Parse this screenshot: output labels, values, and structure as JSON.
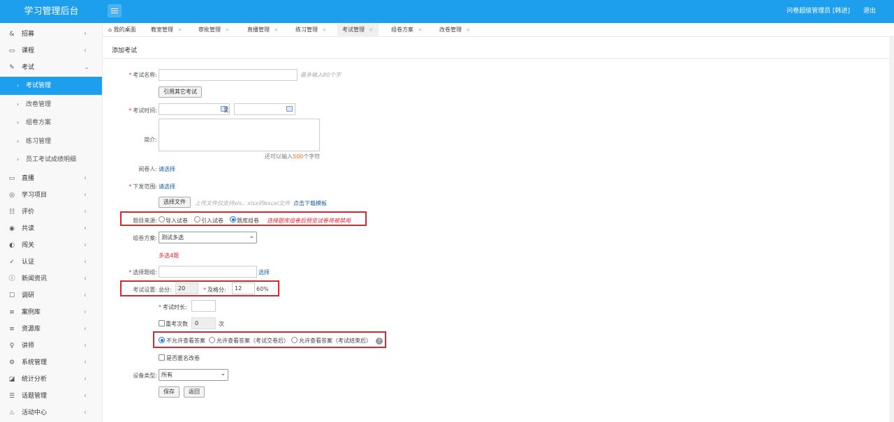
{
  "header": {
    "brand": "学习管理后台",
    "user": "问卷超级管理员 [韩进]",
    "logout": "退出"
  },
  "sidebar": {
    "items": [
      {
        "icon": "&",
        "label": "招募"
      },
      {
        "icon": "▭",
        "label": "课程"
      },
      {
        "icon": "✎",
        "label": "考试",
        "expanded": true,
        "children": [
          "考试管理",
          "改卷管理",
          "组卷方案",
          "练习管理",
          "员工考试成绩明细"
        ]
      },
      {
        "icon": "▭",
        "label": "直播"
      },
      {
        "icon": "◎",
        "label": "学习项目"
      },
      {
        "icon": "☷",
        "label": "评价"
      },
      {
        "icon": "◉",
        "label": "共读"
      },
      {
        "icon": "◐",
        "label": "闯关"
      },
      {
        "icon": "✓",
        "label": "认证"
      },
      {
        "icon": "ⓘ",
        "label": "新闻资讯"
      },
      {
        "icon": "☐",
        "label": "调研"
      },
      {
        "icon": "≡",
        "label": "案例库"
      },
      {
        "icon": "≡",
        "label": "资源库"
      },
      {
        "icon": "♀",
        "label": "讲师"
      },
      {
        "icon": "⚙",
        "label": "系统管理"
      },
      {
        "icon": "◪",
        "label": "统计分析"
      },
      {
        "icon": "☰",
        "label": "话题管理"
      },
      {
        "icon": "♨",
        "label": "活动中心"
      }
    ]
  },
  "tabs": [
    {
      "label": "我的桌面",
      "home": true
    },
    {
      "label": "教室管理"
    },
    {
      "label": "审批管理"
    },
    {
      "label": "直播管理"
    },
    {
      "label": "练习管理"
    },
    {
      "label": "考试管理",
      "active": true
    },
    {
      "label": "组卷方案"
    },
    {
      "label": "改卷管理"
    }
  ],
  "page": {
    "title": "添加考试"
  },
  "form": {
    "exam_name_label": "考试名称:",
    "exam_name_hint": "最多输入80个字",
    "reference_btn": "引用其它考试",
    "exam_time_label": "考试时间:",
    "to": "至",
    "intro_label": "简介:",
    "intro_counter_prefix": "还可以输入",
    "intro_counter_num": "500",
    "intro_counter_suffix": "个字符",
    "grader_label": "阅卷人:",
    "grader_link": "请选择",
    "scope_label": "下发范围:",
    "scope_link": "请选择",
    "choose_file_btn": "选择文件",
    "file_hint": "上传文件仅支持xls、xlsx的excel文件",
    "download_template": "点击下载模板",
    "source_label": "题目来源:",
    "source_options": [
      "导入试卷",
      "引入试卷",
      "题库组卷"
    ],
    "source_selected": 2,
    "source_note": "选择题库组卷后预览试卷将被禁用",
    "plan_label": "组卷方案:",
    "plan_value": "测试多选",
    "plan_info": "多选4题",
    "group_label": "选择题组:",
    "group_link": "选择",
    "settings_label": "考试设置:",
    "total_label": "总分:",
    "total_value": "20",
    "pass_label": "及格分:",
    "pass_value": "12",
    "pass_percent": "60%",
    "duration_label": "考试时长:",
    "retake_label": "重考次数",
    "retake_value": "0",
    "retake_unit": "次",
    "answer_options": [
      "不允许查看答案",
      "允许查看答案（考试交卷后）",
      "允许查看答案（考试结束后）"
    ],
    "answer_selected": 0,
    "anonymous_label": "是否匿名改卷",
    "device_label": "设备类型:",
    "device_value": "所有",
    "save_btn": "保存",
    "back_btn": "返回"
  },
  "colors": {
    "primary": "#1e9fee",
    "highlight": "#e0262d",
    "counter": "#ff6600"
  }
}
